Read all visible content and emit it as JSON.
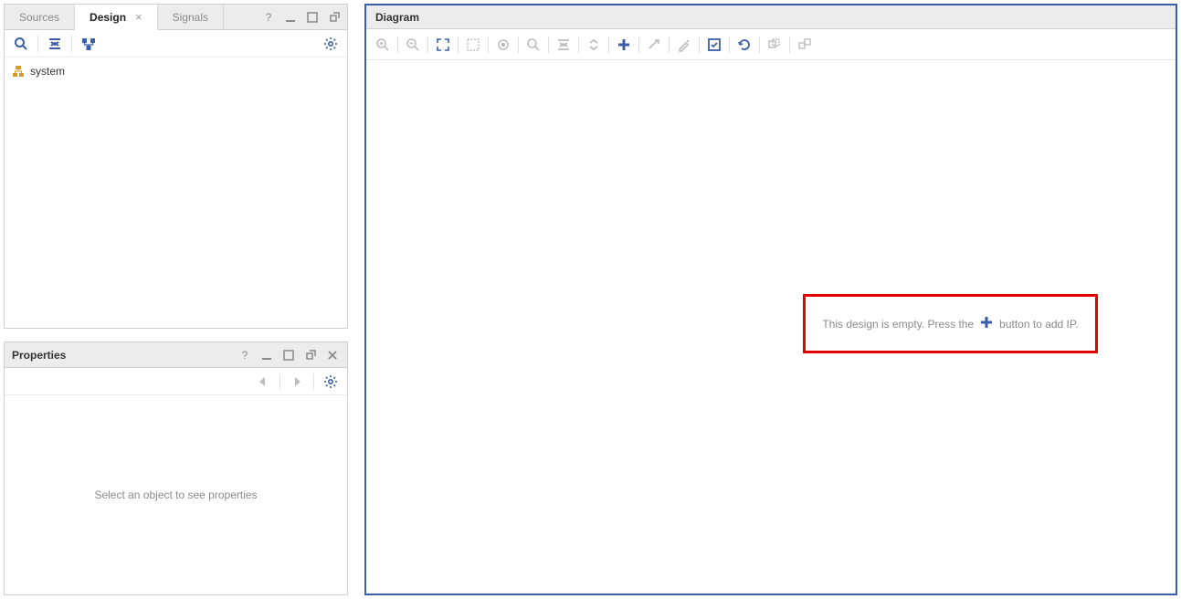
{
  "left": {
    "tabs": {
      "sources": "Sources",
      "design": "Design",
      "signals": "Signals"
    },
    "tree": {
      "root": "system"
    }
  },
  "properties": {
    "title": "Properties",
    "placeholder": "Select an object to see properties"
  },
  "diagram": {
    "title": "Diagram",
    "hint_before": "This design is empty. Press the",
    "hint_after": "button to add IP."
  }
}
